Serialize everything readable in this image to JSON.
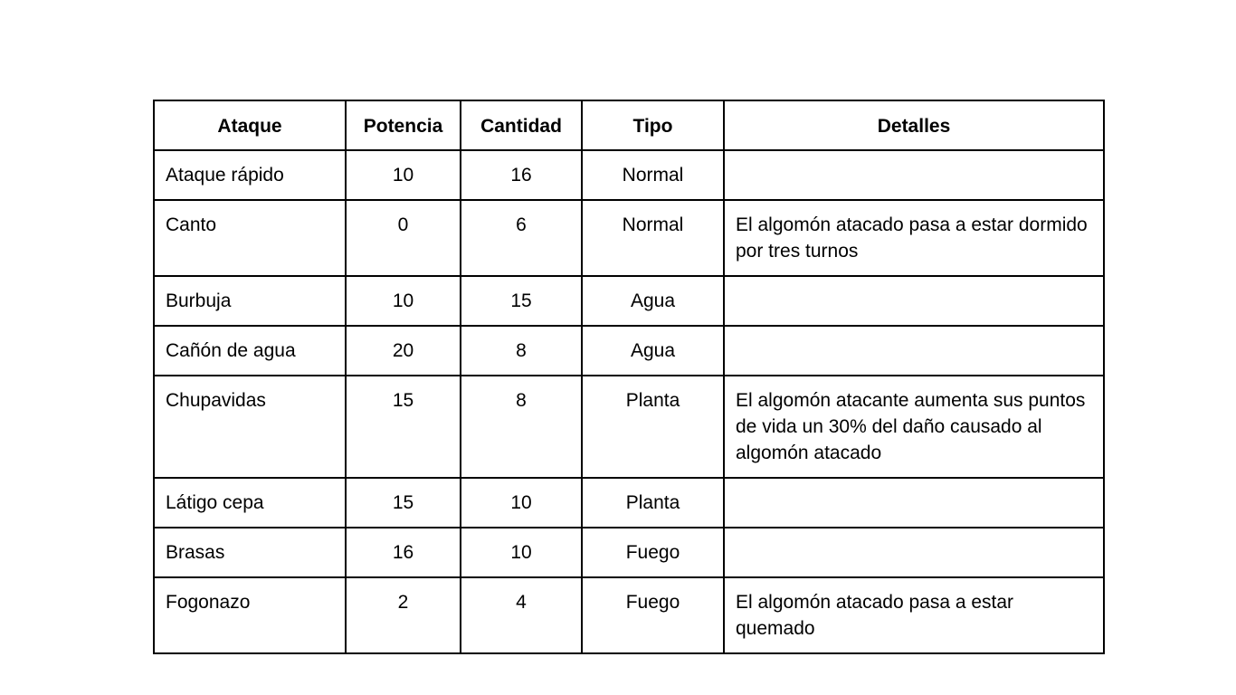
{
  "table": {
    "headers": {
      "ataque": "Ataque",
      "potencia": "Potencia",
      "cantidad": "Cantidad",
      "tipo": "Tipo",
      "detalles": "Detalles"
    },
    "rows": [
      {
        "ataque": "Ataque rápido",
        "potencia": "10",
        "cantidad": "16",
        "tipo": "Normal",
        "detalles": ""
      },
      {
        "ataque": "Canto",
        "potencia": "0",
        "cantidad": "6",
        "tipo": "Normal",
        "detalles": "El algomón atacado pasa a estar dormido por tres turnos"
      },
      {
        "ataque": "Burbuja",
        "potencia": "10",
        "cantidad": "15",
        "tipo": "Agua",
        "detalles": ""
      },
      {
        "ataque": "Cañón de agua",
        "potencia": "20",
        "cantidad": "8",
        "tipo": "Agua",
        "detalles": ""
      },
      {
        "ataque": "Chupavidas",
        "potencia": "15",
        "cantidad": "8",
        "tipo": "Planta",
        "detalles": "El algomón atacante aumenta sus puntos de vida un 30% del daño causado al algomón atacado"
      },
      {
        "ataque": "Látigo cepa",
        "potencia": "15",
        "cantidad": "10",
        "tipo": "Planta",
        "detalles": ""
      },
      {
        "ataque": "Brasas",
        "potencia": "16",
        "cantidad": "10",
        "tipo": "Fuego",
        "detalles": ""
      },
      {
        "ataque": "Fogonazo",
        "potencia": "2",
        "cantidad": "4",
        "tipo": "Fuego",
        "detalles": "El algomón atacado pasa a estar quemado"
      }
    ]
  }
}
